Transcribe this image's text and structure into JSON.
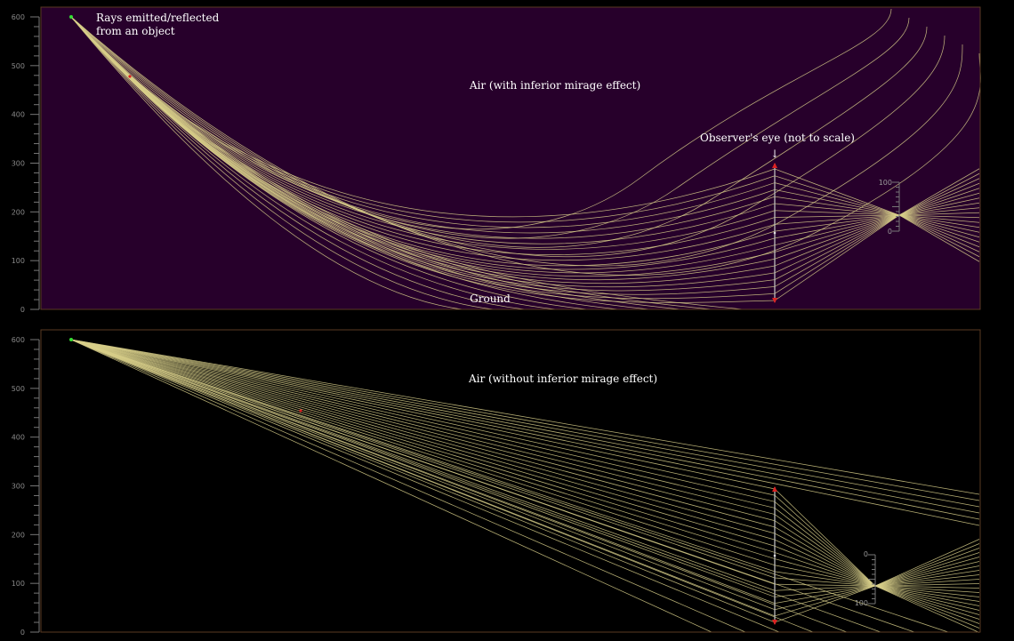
{
  "colors": {
    "panel_top_bg": "#27002b",
    "panel_bottom_bg": "#000000",
    "panel_border": "#5a3a22",
    "ray": "#d8cf8a",
    "source": "#33dd33",
    "marker": "#dd2222",
    "eye_axis": "#bbbbbb",
    "axis": "#777777"
  },
  "y_axis": {
    "min": 0,
    "max": 600,
    "labeled_ticks": [
      "0",
      "100",
      "200",
      "300",
      "400",
      "500",
      "600"
    ]
  },
  "top_panel": {
    "air_label": "Air (with inferior mirage effect)",
    "source_label_line1": "Rays emitted/reflected",
    "source_label_line2": "from an object",
    "eye_label": "Observer's eye (not to scale)",
    "eye_arrow": "↓",
    "ground_label": "Ground",
    "lens_scale_top": "100",
    "lens_scale_bottom": "0"
  },
  "bottom_panel": {
    "air_label": "Air (without inferior mirage effect)",
    "lens_scale_top": "0",
    "lens_scale_bottom": "100"
  }
}
